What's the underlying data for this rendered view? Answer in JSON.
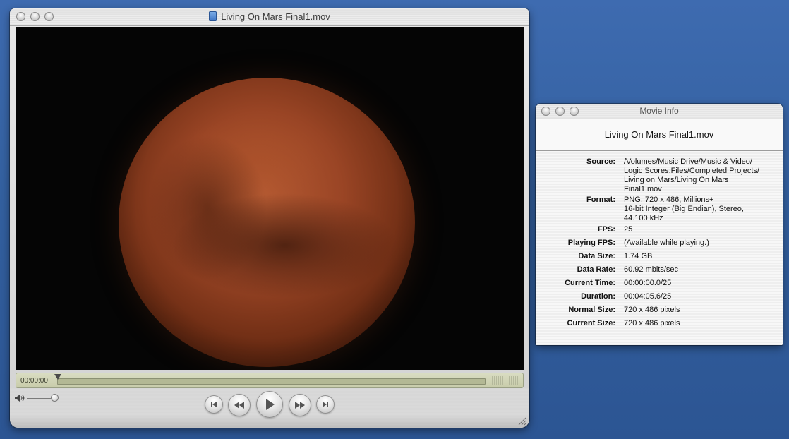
{
  "player": {
    "title": "Living On Mars Final1.mov",
    "current_time": "00:00:00",
    "playhead_progress": 0.0,
    "volume_level": 1.0,
    "icons": [
      "close-icon",
      "minimize-icon",
      "zoom-icon",
      "document-icon",
      "speaker-icon",
      "skip-start-icon",
      "rewind-icon",
      "play-icon",
      "fast-forward-icon",
      "skip-end-icon",
      "resize-grip-icon"
    ]
  },
  "info": {
    "window_title": "Movie Info",
    "file_name": "Living On Mars Final1.mov",
    "rows": [
      {
        "key": "Source:",
        "lines": [
          "/Volumes/Music Drive/Music & Video/",
          "Logic Scores:Files/Completed Projects/",
          "Living on Mars/Living On Mars",
          "Final1.mov"
        ]
      },
      {
        "key": "Format:",
        "lines": [
          "PNG, 720 x 486, Millions+",
          "16-bit Integer (Big Endian), Stereo,",
          "44.100 kHz"
        ]
      },
      {
        "key": "FPS:",
        "lines": [
          "25"
        ]
      },
      {
        "key": "Playing FPS:",
        "lines": [
          "(Available while playing.)"
        ]
      },
      {
        "key": "Data Size:",
        "lines": [
          "1.74 GB"
        ]
      },
      {
        "key": "Data Rate:",
        "lines": [
          "60.92 mbits/sec"
        ]
      },
      {
        "key": "Current Time:",
        "lines": [
          "00:00:00.0/25"
        ]
      },
      {
        "key": "Duration:",
        "lines": [
          "00:04:05.6/25"
        ]
      },
      {
        "key": "Normal Size:",
        "lines": [
          "720 x 486  pixels"
        ]
      },
      {
        "key": "Current Size:",
        "lines": [
          "720 x 486  pixels"
        ]
      }
    ]
  }
}
